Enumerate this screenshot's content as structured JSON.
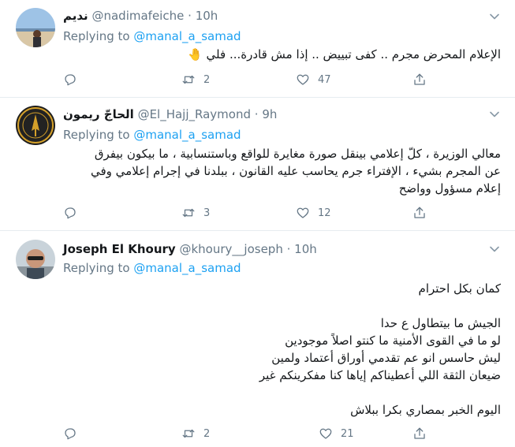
{
  "tweets": [
    {
      "display_name": "نديم",
      "handle": "@nadimafeiche",
      "time": "10h",
      "replying_prefix": "Replying to",
      "replying_to": "@manal_a_samad",
      "lines": [
        "الإعلام المحرض  مجرم .. كفى  تبييض .. إذا مش قادرة... فلي 🤚"
      ],
      "replies": "",
      "retweets": "2",
      "likes": "47"
    },
    {
      "display_name": "الحاجّ ريمون",
      "handle": "@El_Hajj_Raymond",
      "time": "9h",
      "replying_prefix": "Replying to",
      "replying_to": "@manal_a_samad",
      "lines": [
        "معالي الوزيرة ، كلّ إعلامي بينقل صورة مغايرة للواقع وباستنسابية ، ما بيكون بيفرق",
        "عن المجرم بشيء ، الإفتراء جرم يحاسب عليه القانون ، ببلدنا في إجرام إعلامي وفي",
        "إعلام مسؤول وواضح"
      ],
      "replies": "",
      "retweets": "3",
      "likes": "12"
    },
    {
      "display_name": "Joseph El Khoury",
      "handle": "@khoury__joseph",
      "time": "10h",
      "replying_prefix": "Replying to",
      "replying_to": "@manal_a_samad",
      "lines": [
        "كمان بكل احترام",
        "",
        "الجيش ما بيتطاول ع حدا",
        "لو ما في القوى الأمنية ما كنتو اصلاً موجودين",
        "ليش حاسس انو عم تقدمي أوراق أعتماد ولمين",
        "ضيعان الثقة اللي أعطيناكم إياها كنا مفكرينكم غير",
        "",
        "اليوم الخبر بمصاري بكرا ببلاش"
      ],
      "replies": "",
      "retweets": "2",
      "likes": "21"
    }
  ],
  "icons": {
    "reply": "reply-icon",
    "retweet": "retweet-icon",
    "like": "heart-icon",
    "share": "share-icon",
    "more": "chevron-down-icon"
  },
  "colors": {
    "text": "#14171a",
    "muted": "#657786",
    "link": "#1da1f2",
    "divider": "#e6ecf0"
  }
}
